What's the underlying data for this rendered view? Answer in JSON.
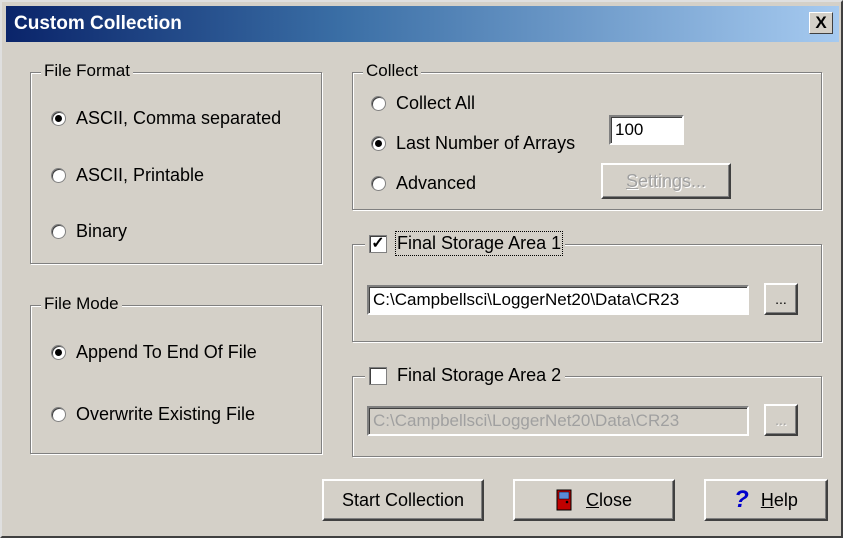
{
  "window": {
    "title": "Custom Collection",
    "close_glyph": "X"
  },
  "file_format": {
    "legend": "File Format",
    "options": [
      {
        "label": "ASCII, Comma separated",
        "selected": true
      },
      {
        "label": "ASCII, Printable",
        "selected": false
      },
      {
        "label": "Binary",
        "selected": false
      }
    ]
  },
  "file_mode": {
    "legend": "File Mode",
    "options": [
      {
        "label": "Append To End Of File",
        "selected": true
      },
      {
        "label": "Overwrite Existing File",
        "selected": false
      }
    ]
  },
  "collect": {
    "legend": "Collect",
    "options": [
      {
        "label": "Collect All",
        "selected": false
      },
      {
        "label": "Last Number of Arrays",
        "selected": true
      },
      {
        "label": "Advanced",
        "selected": false
      }
    ],
    "arrays_value": "100",
    "settings_button": {
      "label_access": "S",
      "label_rest": "ettings...",
      "enabled": false
    }
  },
  "fsa1": {
    "label": "Final Storage Area 1",
    "checked": true,
    "path": "C:\\Campbellsci\\LoggerNet20\\Data\\CR23",
    "browse": "..."
  },
  "fsa2": {
    "label": "Final Storage Area 2",
    "checked": false,
    "path": "C:\\Campbellsci\\LoggerNet20\\Data\\CR23",
    "browse": "..."
  },
  "buttons": {
    "start": "Start Collection",
    "close_access": "C",
    "close_rest": "lose",
    "help_access": "H",
    "help_rest": "elp"
  },
  "icons": {
    "close": "door-icon",
    "help": "question-mark-icon"
  },
  "colors": {
    "titlebar_start": "#0a246a",
    "titlebar_end": "#a6caf0",
    "face": "#d4d0c8",
    "door": "#c00000",
    "help": "#0000cc"
  }
}
